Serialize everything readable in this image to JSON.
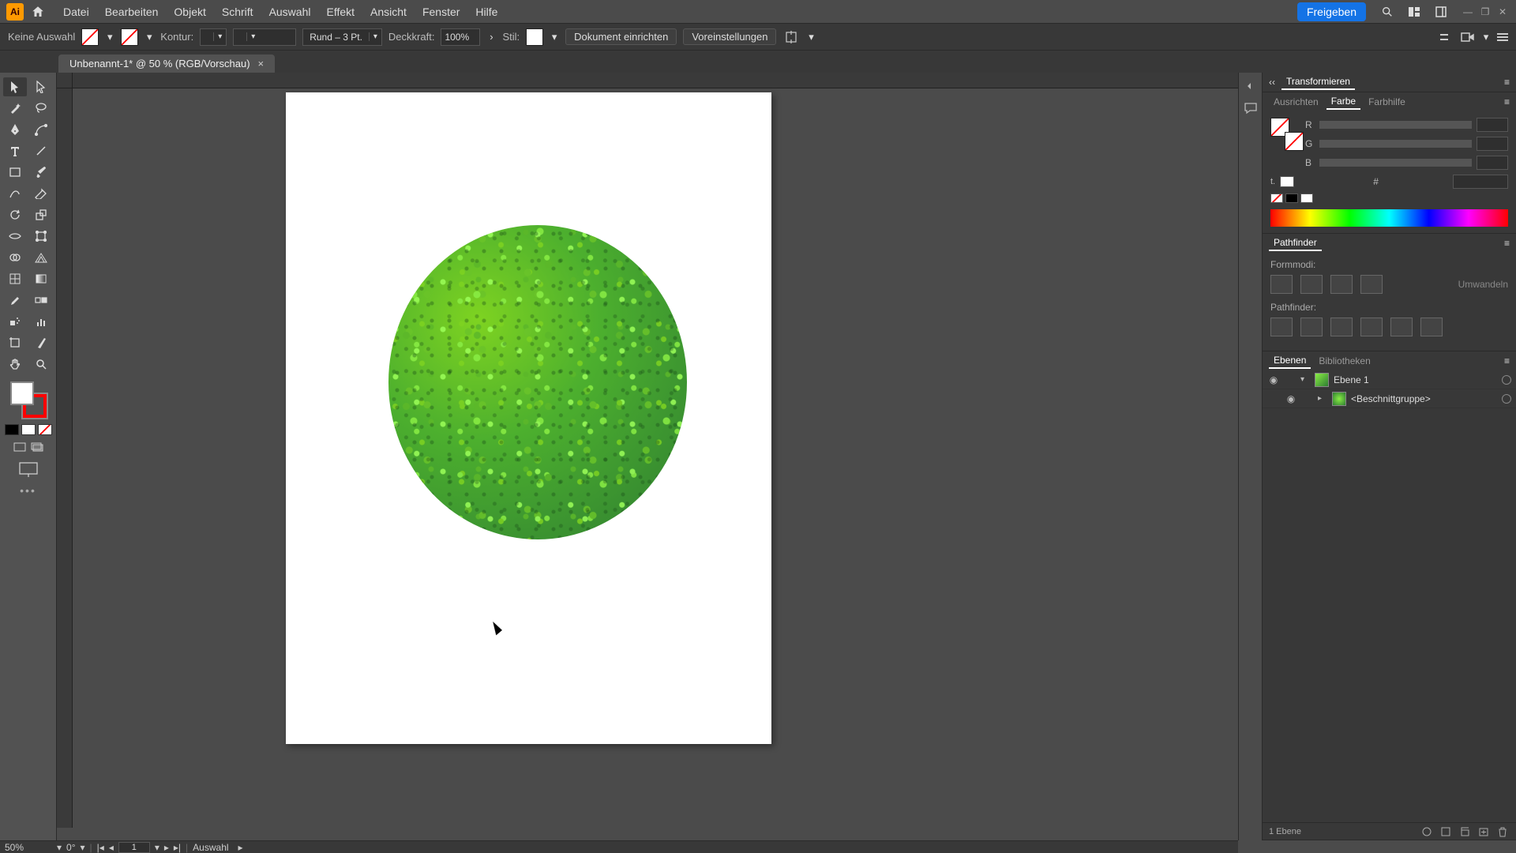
{
  "app": {
    "initials": "Ai"
  },
  "menu": {
    "items": [
      "Datei",
      "Bearbeiten",
      "Objekt",
      "Schrift",
      "Auswahl",
      "Effekt",
      "Ansicht",
      "Fenster",
      "Hilfe"
    ],
    "share": "Freigeben"
  },
  "controlbar": {
    "selection_status": "Keine Auswahl",
    "stroke_label": "Kontur:",
    "brush": "Rund – 3 Pt.",
    "opacity_label": "Deckkraft:",
    "opacity_value": "100%",
    "style_label": "Stil:",
    "doc_setup": "Dokument einrichten",
    "prefs": "Voreinstellungen"
  },
  "tab": {
    "title": "Unbenannt-1* @ 50 % (RGB/Vorschau)"
  },
  "panels": {
    "transform": {
      "title": "Transformieren"
    },
    "color_row": {
      "tabs": [
        "Ausrichten",
        "Farbe",
        "Farbhilfe"
      ],
      "active": 1,
      "channels": [
        "R",
        "G",
        "B"
      ],
      "hex_label": "#"
    },
    "pathfinder": {
      "title": "Pathfinder",
      "shape_modes": "Formmodi:",
      "pathfinders": "Pathfinder:",
      "expand": "Umwandeln"
    },
    "layers": {
      "tabs": [
        "Ebenen",
        "Bibliotheken"
      ],
      "active": 0,
      "rows": [
        {
          "name": "Ebene 1",
          "expanded": true,
          "level": 0
        },
        {
          "name": "<Beschnittgruppe>",
          "expanded": false,
          "level": 1
        }
      ],
      "footer_count": "1 Ebene"
    }
  },
  "status": {
    "zoom": "50%",
    "rotation": "0°",
    "artboard_nav": "1",
    "tool": "Auswahl"
  }
}
